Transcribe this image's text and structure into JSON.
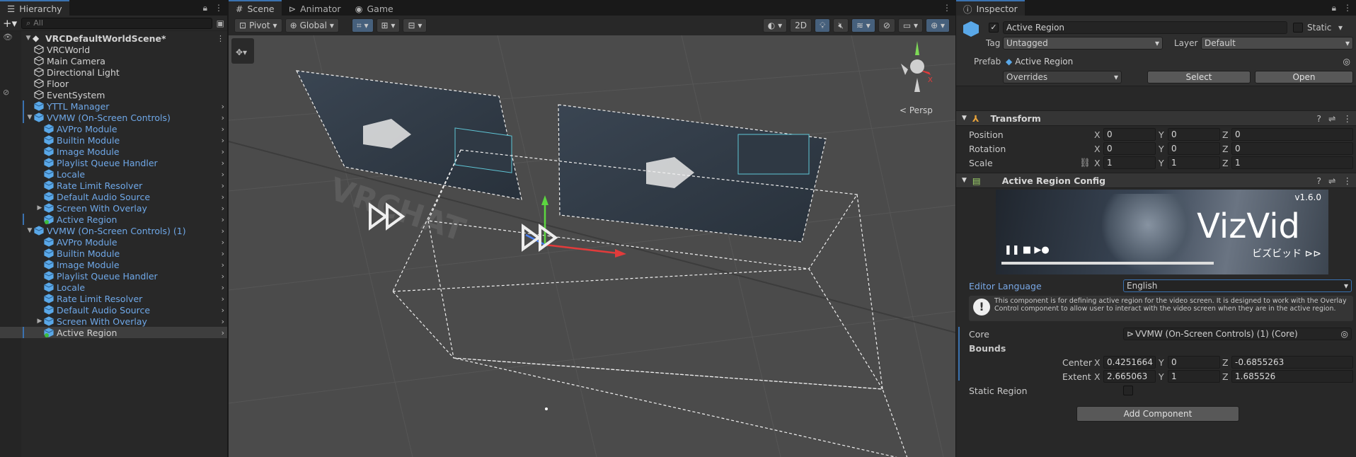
{
  "hierarchy": {
    "tab": "Hierarchy",
    "search_placeholder": "All",
    "scene_name": "VRCDefaultWorldScene*",
    "items": [
      {
        "label": "VRCWorld",
        "depth": 1,
        "type": "go",
        "blue": false,
        "chevron": false,
        "arrow": ""
      },
      {
        "label": "Main Camera",
        "depth": 1,
        "type": "go",
        "blue": false,
        "chevron": false,
        "arrow": ""
      },
      {
        "label": "Directional Light",
        "depth": 1,
        "type": "go",
        "blue": false,
        "chevron": false,
        "arrow": ""
      },
      {
        "label": "Floor",
        "depth": 1,
        "type": "go",
        "blue": false,
        "chevron": false,
        "arrow": ""
      },
      {
        "label": "EventSystem",
        "depth": 1,
        "type": "go",
        "blue": false,
        "chevron": false,
        "arrow": ""
      },
      {
        "label": "YTTL Manager",
        "depth": 1,
        "type": "prefab",
        "blue": true,
        "chevron": true,
        "arrow": "",
        "bar": true
      },
      {
        "label": "VVMW (On-Screen Controls)",
        "depth": 1,
        "type": "prefab",
        "blue": true,
        "chevron": true,
        "arrow": "down",
        "bar": true
      },
      {
        "label": "AVPro Module",
        "depth": 2,
        "type": "prefab",
        "blue": true,
        "chevron": true,
        "arrow": ""
      },
      {
        "label": "Builtin Module",
        "depth": 2,
        "type": "prefab",
        "blue": true,
        "chevron": true,
        "arrow": ""
      },
      {
        "label": "Image Module",
        "depth": 2,
        "type": "prefab",
        "blue": true,
        "chevron": true,
        "arrow": ""
      },
      {
        "label": "Playlist Queue Handler",
        "depth": 2,
        "type": "prefab",
        "blue": true,
        "chevron": true,
        "arrow": ""
      },
      {
        "label": "Locale",
        "depth": 2,
        "type": "prefab",
        "blue": true,
        "chevron": true,
        "arrow": ""
      },
      {
        "label": "Rate Limit Resolver",
        "depth": 2,
        "type": "prefab",
        "blue": true,
        "chevron": true,
        "arrow": ""
      },
      {
        "label": "Default Audio Source",
        "depth": 2,
        "type": "prefab",
        "blue": true,
        "chevron": true,
        "arrow": ""
      },
      {
        "label": "Screen With Overlay",
        "depth": 2,
        "type": "prefab",
        "blue": true,
        "chevron": true,
        "arrow": "right"
      },
      {
        "label": "Active Region",
        "depth": 2,
        "type": "prefab-add",
        "blue": true,
        "chevron": true,
        "arrow": "",
        "bar": true
      },
      {
        "label": "VVMW (On-Screen Controls) (1)",
        "depth": 1,
        "type": "prefab",
        "blue": true,
        "chevron": true,
        "arrow": "down"
      },
      {
        "label": "AVPro Module",
        "depth": 2,
        "type": "prefab",
        "blue": true,
        "chevron": true,
        "arrow": ""
      },
      {
        "label": "Builtin Module",
        "depth": 2,
        "type": "prefab",
        "blue": true,
        "chevron": true,
        "arrow": ""
      },
      {
        "label": "Image Module",
        "depth": 2,
        "type": "prefab",
        "blue": true,
        "chevron": true,
        "arrow": ""
      },
      {
        "label": "Playlist Queue Handler",
        "depth": 2,
        "type": "prefab",
        "blue": true,
        "chevron": true,
        "arrow": ""
      },
      {
        "label": "Locale",
        "depth": 2,
        "type": "prefab",
        "blue": true,
        "chevron": true,
        "arrow": ""
      },
      {
        "label": "Rate Limit Resolver",
        "depth": 2,
        "type": "prefab",
        "blue": true,
        "chevron": true,
        "arrow": ""
      },
      {
        "label": "Default Audio Source",
        "depth": 2,
        "type": "prefab",
        "blue": true,
        "chevron": true,
        "arrow": ""
      },
      {
        "label": "Screen With Overlay",
        "depth": 2,
        "type": "prefab",
        "blue": true,
        "chevron": true,
        "arrow": "right"
      },
      {
        "label": "Active Region",
        "depth": 2,
        "type": "prefab-add",
        "blue": false,
        "chevron": true,
        "arrow": "",
        "selected": true,
        "bar": true
      }
    ]
  },
  "scene": {
    "tabs": [
      "Scene",
      "Animator",
      "Game"
    ],
    "pivot": "Pivot",
    "global": "Global",
    "mode_2d": "2D",
    "persp": "Persp",
    "watermark": "VRCHAT"
  },
  "inspector": {
    "tab": "Inspector",
    "object_name": "Active Region",
    "static_label": "Static",
    "tag_label": "Tag",
    "tag_value": "Untagged",
    "layer_label": "Layer",
    "layer_value": "Default",
    "prefab_label": "Prefab",
    "prefab_value": "Active Region",
    "overrides": "Overrides",
    "select": "Select",
    "open": "Open",
    "transform": {
      "title": "Transform",
      "position_label": "Position",
      "rotation_label": "Rotation",
      "scale_label": "Scale",
      "position": [
        "0",
        "0",
        "0"
      ],
      "rotation": [
        "0",
        "0",
        "0"
      ],
      "scale": [
        "1",
        "1",
        "1"
      ]
    },
    "config": {
      "title": "Active Region Config",
      "banner_title": "VizVid",
      "banner_sub": "ビズビッド",
      "banner_version": "v1.6.0",
      "editor_language_label": "Editor Language",
      "editor_language_value": "English",
      "info": "This component is for defining active region for the video screen. It is designed to work with the Overlay Control component to allow user to interact with the video screen when they are in the active region.",
      "core_label": "Core",
      "core_value": "VVMW (On-Screen Controls) (1) (Core)",
      "bounds_label": "Bounds",
      "center_label": "Center",
      "extent_label": "Extent",
      "center": [
        "0.4251664",
        "0",
        "-0.6855263"
      ],
      "extent": [
        "2.665063",
        "1",
        "1.685526"
      ],
      "static_region_label": "Static Region"
    },
    "add_component": "Add Component",
    "axes": [
      "X",
      "Y",
      "Z"
    ]
  }
}
